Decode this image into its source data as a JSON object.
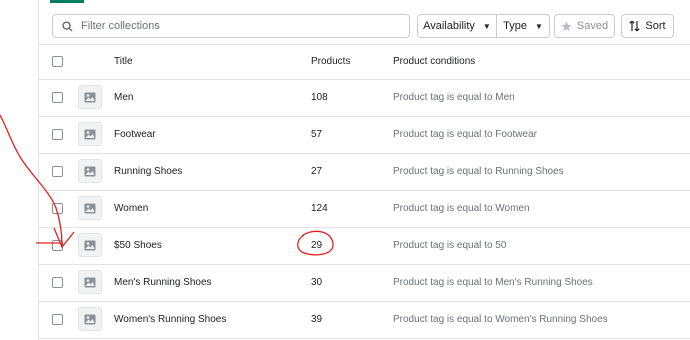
{
  "search": {
    "placeholder": "Filter collections",
    "value": ""
  },
  "filters": {
    "availability": "Availability",
    "type": "Type",
    "saved": "Saved",
    "sort": "Sort"
  },
  "table": {
    "headers": {
      "title": "Title",
      "products": "Products",
      "conditions": "Product conditions"
    },
    "rows": [
      {
        "title": "Men",
        "products": "108",
        "condition": "Product tag is equal to Men"
      },
      {
        "title": "Footwear",
        "products": "57",
        "condition": "Product tag is equal to Footwear"
      },
      {
        "title": "Running Shoes",
        "products": "27",
        "condition": "Product tag is equal to Running Shoes"
      },
      {
        "title": "Women",
        "products": "124",
        "condition": "Product tag is equal to Women"
      },
      {
        "title": "$50 Shoes",
        "products": "29",
        "condition": "Product tag is equal to 50"
      },
      {
        "title": "Men's Running Shoes",
        "products": "30",
        "condition": "Product tag is equal to Men's Running Shoes"
      },
      {
        "title": "Women's Running Shoes",
        "products": "39",
        "condition": "Product tag is equal to Women's Running Shoes"
      }
    ]
  },
  "colors": {
    "accent": "#008060",
    "annotation": "#e02020",
    "border": "#e1e3e5",
    "muted_text": "#6d7175"
  },
  "icons": [
    "search-icon",
    "caret-down-icon",
    "star-icon",
    "sort-icon",
    "image-placeholder-icon"
  ]
}
